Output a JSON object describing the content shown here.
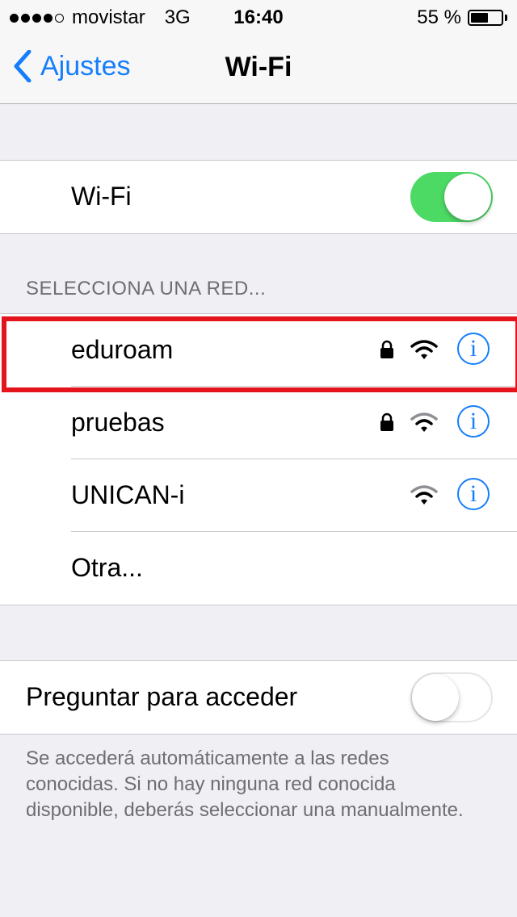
{
  "status_bar": {
    "signal_dots": [
      true,
      true,
      true,
      true,
      false
    ],
    "carrier": "movistar",
    "network_type": "3G",
    "time": "16:40",
    "battery_percent": "55 %",
    "battery_level": 0.55
  },
  "nav": {
    "back_label": "Ajustes",
    "title": "Wi-Fi"
  },
  "wifi_toggle": {
    "label": "Wi-Fi",
    "state": "on"
  },
  "networks_section": {
    "header": "SELECCIONA UNA RED...",
    "networks": [
      {
        "name": "eduroam",
        "secured": true,
        "signal_icon": "wifi-icon",
        "highlighted": true
      },
      {
        "name": "pruebas",
        "secured": true,
        "signal_icon": "wifi-icon"
      },
      {
        "name": "UNICAN-i",
        "secured": false,
        "signal_icon": "wifi-icon"
      }
    ],
    "other_label": "Otra..."
  },
  "ask_to_join": {
    "label": "Preguntar para acceder",
    "state": "off",
    "note": "Se accederá automáticamente a las redes conocidas. Si no hay ninguna red conocida disponible, deberás seleccionar una manualmente."
  },
  "info_glyph": "i",
  "colors": {
    "accent": "#157efb",
    "toggle_on": "#4cd964",
    "highlight": "#e3141c",
    "background": "#efeff4"
  }
}
